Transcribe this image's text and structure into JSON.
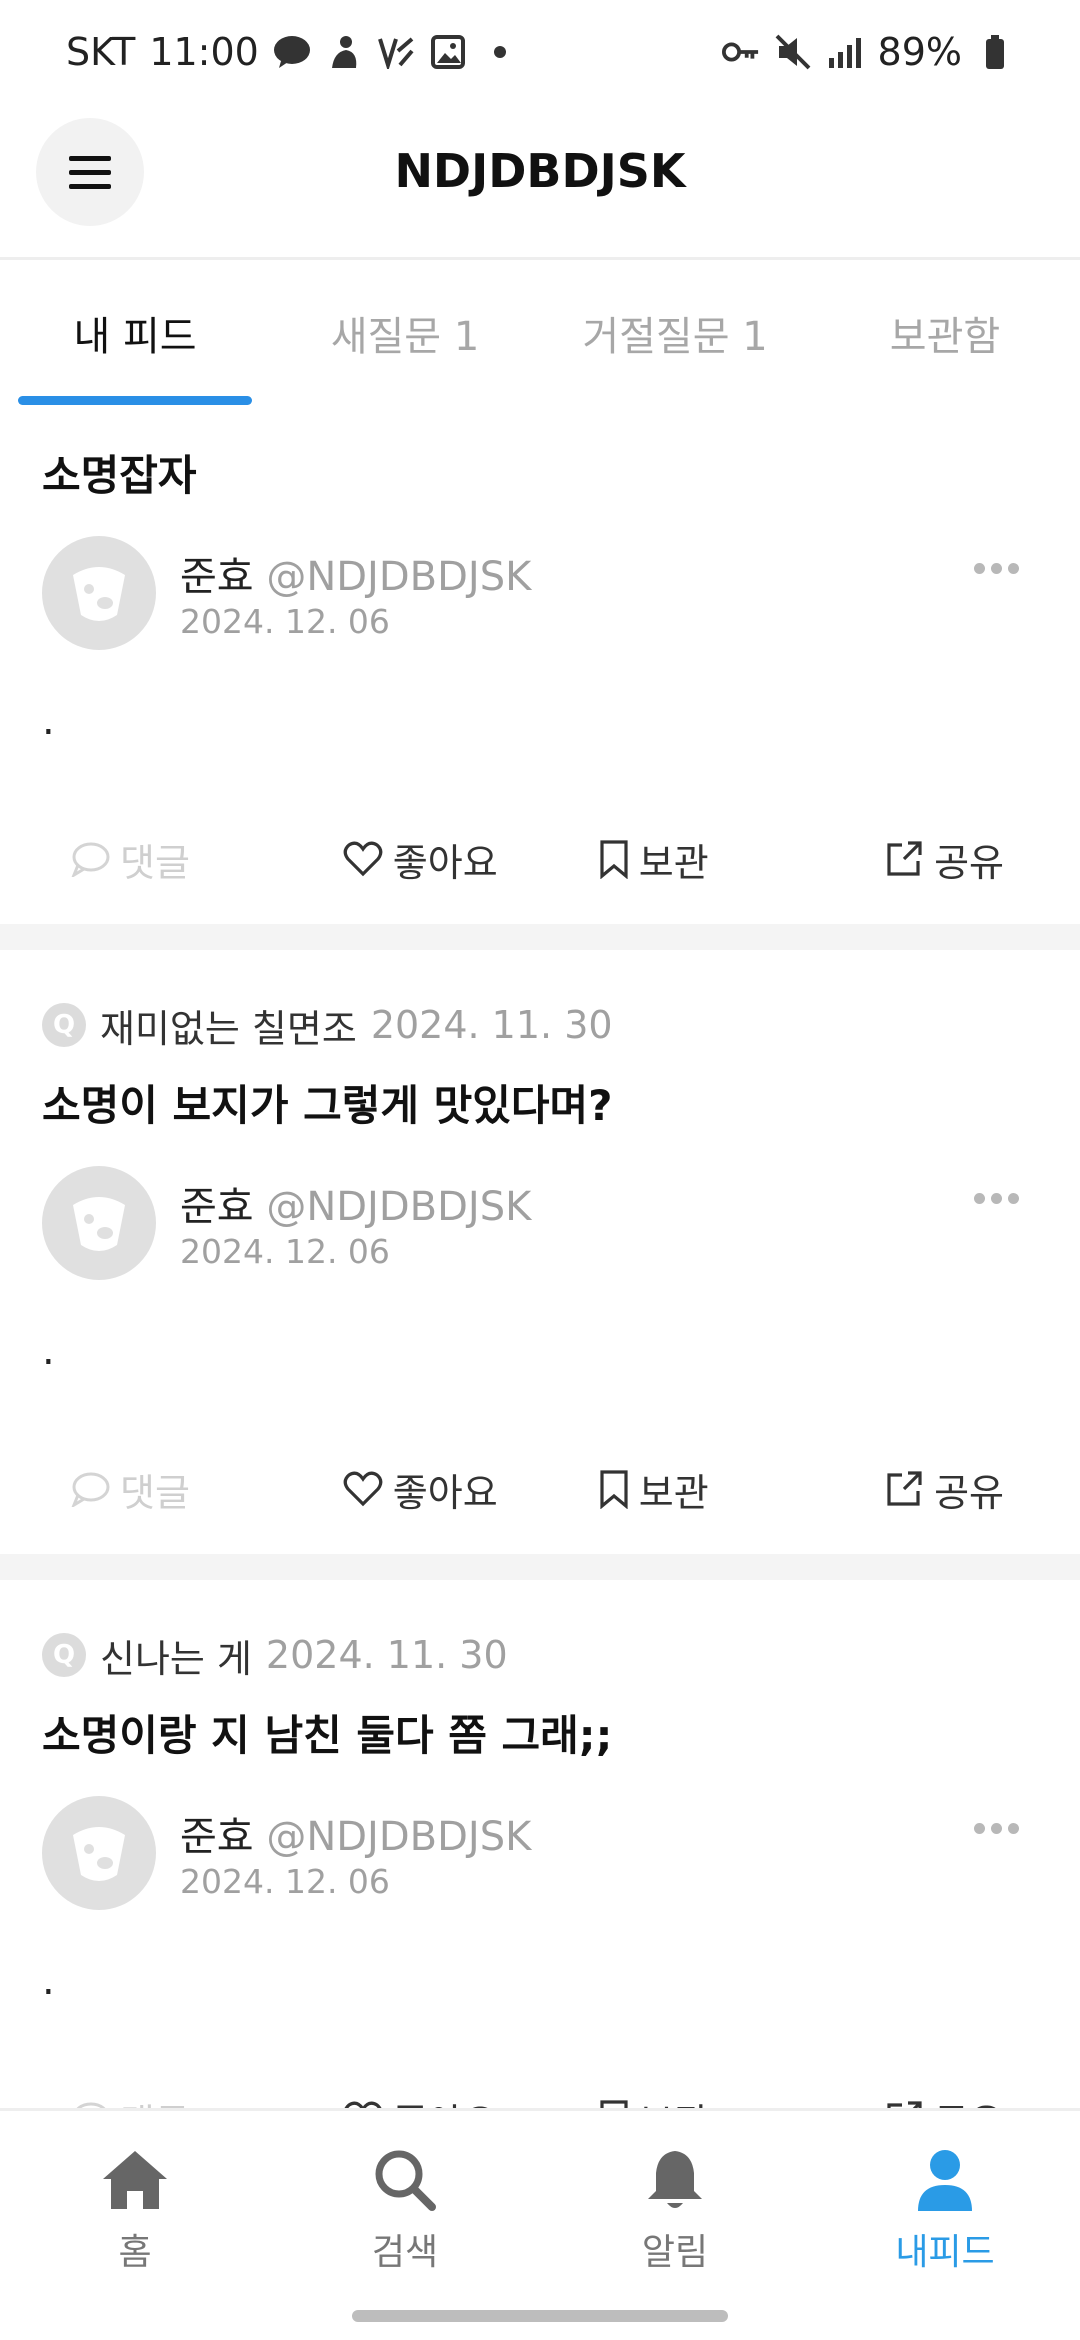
{
  "status_bar": {
    "carrier": "SKT",
    "time": "11:00",
    "notification_icons": [
      "talk-icon",
      "figure-icon",
      "vpn-icon",
      "image-icon",
      "dot-icon"
    ],
    "system_icons": [
      "key-icon",
      "mute-icon",
      "signal-icon"
    ],
    "battery": "89%"
  },
  "header": {
    "title": "NDJDBDJSK"
  },
  "tabs": [
    {
      "label": "내 피드",
      "active": true
    },
    {
      "label": "새질문 1",
      "active": false
    },
    {
      "label": "거절질문 1",
      "active": false
    },
    {
      "label": "보관함",
      "active": false
    }
  ],
  "feed": [
    {
      "question_meta": {
        "asker": "",
        "date": ""
      },
      "question": "소명잡자",
      "author": {
        "name": "준효",
        "handle": "@NDJDBDJSK",
        "date": "2024. 12. 06"
      },
      "answer": ".",
      "actions": {
        "comment": "댓글",
        "like": "좋아요",
        "save": "보관",
        "share": "공유"
      }
    },
    {
      "question_meta": {
        "asker": "재미없는 칠면조",
        "date": "2024. 11. 30"
      },
      "question": "소명이 보지가 그렇게 맛있다며?",
      "author": {
        "name": "준효",
        "handle": "@NDJDBDJSK",
        "date": "2024. 12. 06"
      },
      "answer": ".",
      "actions": {
        "comment": "댓글",
        "like": "좋아요",
        "save": "보관",
        "share": "공유"
      }
    },
    {
      "question_meta": {
        "asker": "신나는 게",
        "date": "2024. 11. 30"
      },
      "question": "소명이랑 지 남친 둘다 쫌 그래;;",
      "author": {
        "name": "준효",
        "handle": "@NDJDBDJSK",
        "date": "2024. 12. 06"
      },
      "answer": ".",
      "actions": {
        "comment": "댓글",
        "like": "좋아요",
        "save": "보관",
        "share": "공유"
      }
    }
  ],
  "badge_letter": "Q",
  "bottom_nav": [
    {
      "label": "홈",
      "icon": "home-icon",
      "active": false
    },
    {
      "label": "검색",
      "icon": "search-icon",
      "active": false
    },
    {
      "label": "알림",
      "icon": "bell-icon",
      "active": false
    },
    {
      "label": "내피드",
      "icon": "person-icon",
      "active": true
    }
  ],
  "colors": {
    "accent": "#2a9be6",
    "tab_underline": "#2a8fe6",
    "muted": "#a0a0a0"
  }
}
